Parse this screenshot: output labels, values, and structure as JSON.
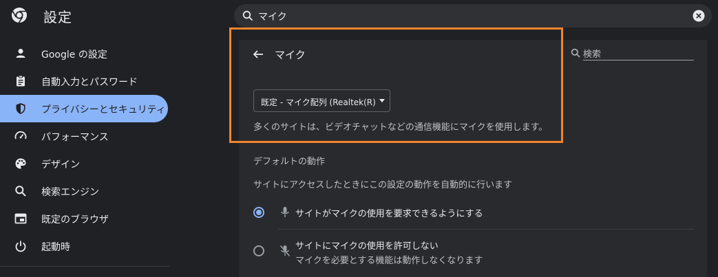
{
  "header": {
    "title": "設定",
    "search_value": "マイク"
  },
  "sidebar": {
    "items": [
      {
        "label": "Google の設定",
        "icon": "person-icon"
      },
      {
        "label": "自動入力とパスワード",
        "icon": "clipboard-icon"
      },
      {
        "label": "プライバシーとセキュリティ",
        "icon": "shield-icon",
        "active": true
      },
      {
        "label": "パフォーマンス",
        "icon": "speedometer-icon"
      },
      {
        "label": "デザイン",
        "icon": "palette-icon"
      },
      {
        "label": "検索エンジン",
        "icon": "search-icon"
      },
      {
        "label": "既定のブラウザ",
        "icon": "browser-icon"
      },
      {
        "label": "起動時",
        "icon": "power-icon"
      }
    ]
  },
  "page": {
    "title": "マイク",
    "search_placeholder": "検索",
    "device_select": "既定 - マイク配列 (Realtek(R) Audio)",
    "description": "多くのサイトは、ビデオチャットなどの通信機能にマイクを使用します。",
    "default_behavior": {
      "heading": "デフォルトの動作",
      "description": "サイトにアクセスしたときにこの設定の動作を自動的に行います",
      "options": [
        {
          "label": "サイトがマイクの使用を要求できるようにする",
          "selected": true
        },
        {
          "label": "サイトにマイクの使用を許可しない",
          "sublabel": "マイクを必要とする機能は動作しなくなります",
          "selected": false
        }
      ]
    }
  },
  "colors": {
    "background": "#202124",
    "card": "#292a2d",
    "accent": "#8ab4f8",
    "highlight": "#f4862d"
  }
}
